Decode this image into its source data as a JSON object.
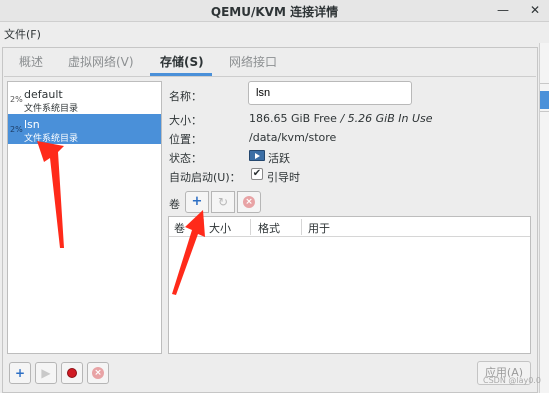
{
  "window": {
    "title": "QEMU/KVM 连接详情",
    "minimize_glyph": "—",
    "close_glyph": "✕"
  },
  "menu": {
    "file": "文件(F)"
  },
  "tabs": [
    {
      "label": "概述",
      "active": false
    },
    {
      "label": "虚拟网络(V)",
      "active": false
    },
    {
      "label": "存储(S)",
      "active": true
    },
    {
      "label": "网络接口",
      "active": false
    }
  ],
  "pools": [
    {
      "percent": "2%",
      "name": "default",
      "type": "文件系统目录",
      "selected": false
    },
    {
      "percent": "2%",
      "name": "lsn",
      "type": "文件系统目录",
      "selected": true
    }
  ],
  "details": {
    "name_label": "名称：",
    "name_value": "lsn",
    "size_label": "大小：",
    "size_free": "186.65 GiB Free",
    "size_sep": " / ",
    "size_inuse": "5.26 GiB In Use",
    "location_label": "位置：",
    "location_value": "/data/kvm/store",
    "state_label": "状态：",
    "state_value": "活跃",
    "autostart_label": "自动启动(U)：",
    "autostart_value": "引导时",
    "autostart_checked": true,
    "checkmark": "✔"
  },
  "volumes": {
    "label": "卷",
    "columns": [
      "卷",
      "大小",
      "格式",
      "用于"
    ],
    "rows": []
  },
  "buttons": {
    "apply": "应用(A)"
  },
  "icons": {
    "add": "+",
    "start": "▶",
    "stop": "stop-icon",
    "delete": "×",
    "refresh": "↻"
  },
  "watermark": "CSDN @lay0.0",
  "colors": {
    "selection": "#4a90d9",
    "annotation_arrow": "#ff2a1a",
    "stop_red": "#d01b24"
  }
}
